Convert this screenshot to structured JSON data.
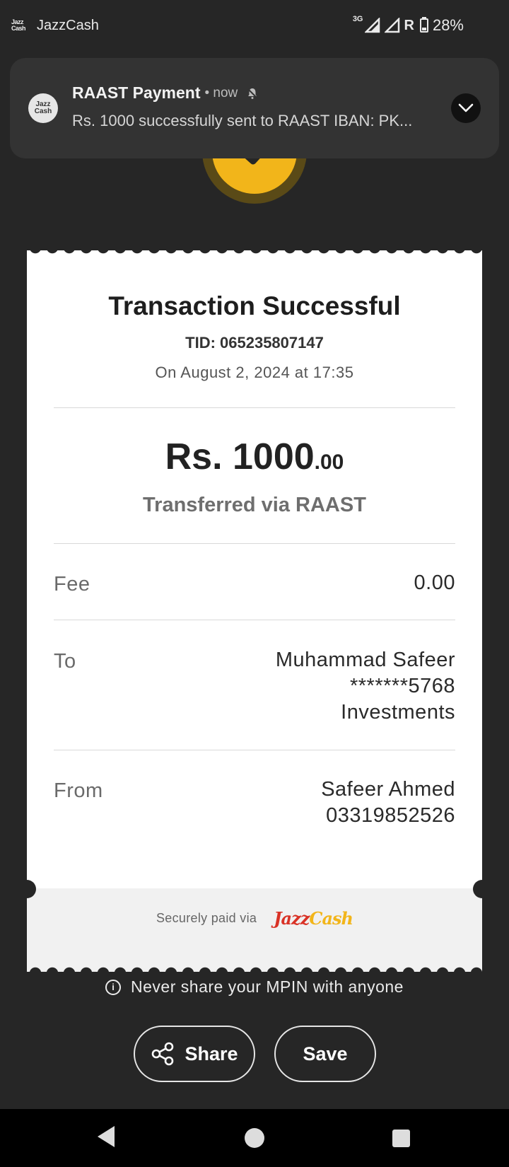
{
  "status_bar": {
    "app_logo_line1": "Jazz",
    "app_logo_line2": "Cash",
    "app_name": "JazzCash",
    "network": "3G",
    "roaming": "R",
    "battery": "28%"
  },
  "notification": {
    "icon_line1": "Jazz",
    "icon_line2": "Cash",
    "title": "RAAST Payment",
    "time": "• now",
    "text": "Rs. 1000 successfully sent to RAAST IBAN: PK..."
  },
  "receipt": {
    "title": "Transaction Successful",
    "tid": "TID: 065235807147",
    "date": "On August 2, 2024 at 17:35",
    "amount_main": "Rs. 1000",
    "amount_decimal": ".00",
    "transfer_method": "Transferred via RAAST",
    "fee_label": "Fee",
    "fee_value": "0.00",
    "to_label": "To",
    "to_name": "Muhammad Safeer",
    "to_account": "*******5768",
    "to_bank": "Investments",
    "from_label": "From",
    "from_name": "Safeer Ahmed",
    "from_number": "03319852526",
    "secure_text": "Securely paid via",
    "brand_part1": "Jazz",
    "brand_part2": "Cash"
  },
  "warning": {
    "icon": "i",
    "text": "Never share your MPIN with anyone"
  },
  "actions": {
    "share_label": "Share",
    "save_label": "Save"
  },
  "colors": {
    "background": "#262626",
    "accent_yellow": "#f2b51a",
    "brand_red": "#d93226"
  },
  "icons": [
    "share-icon",
    "info-icon",
    "bell-off-icon",
    "chevron-down-icon",
    "back-icon",
    "home-icon",
    "recents-icon",
    "signal-icon",
    "battery-icon"
  ]
}
